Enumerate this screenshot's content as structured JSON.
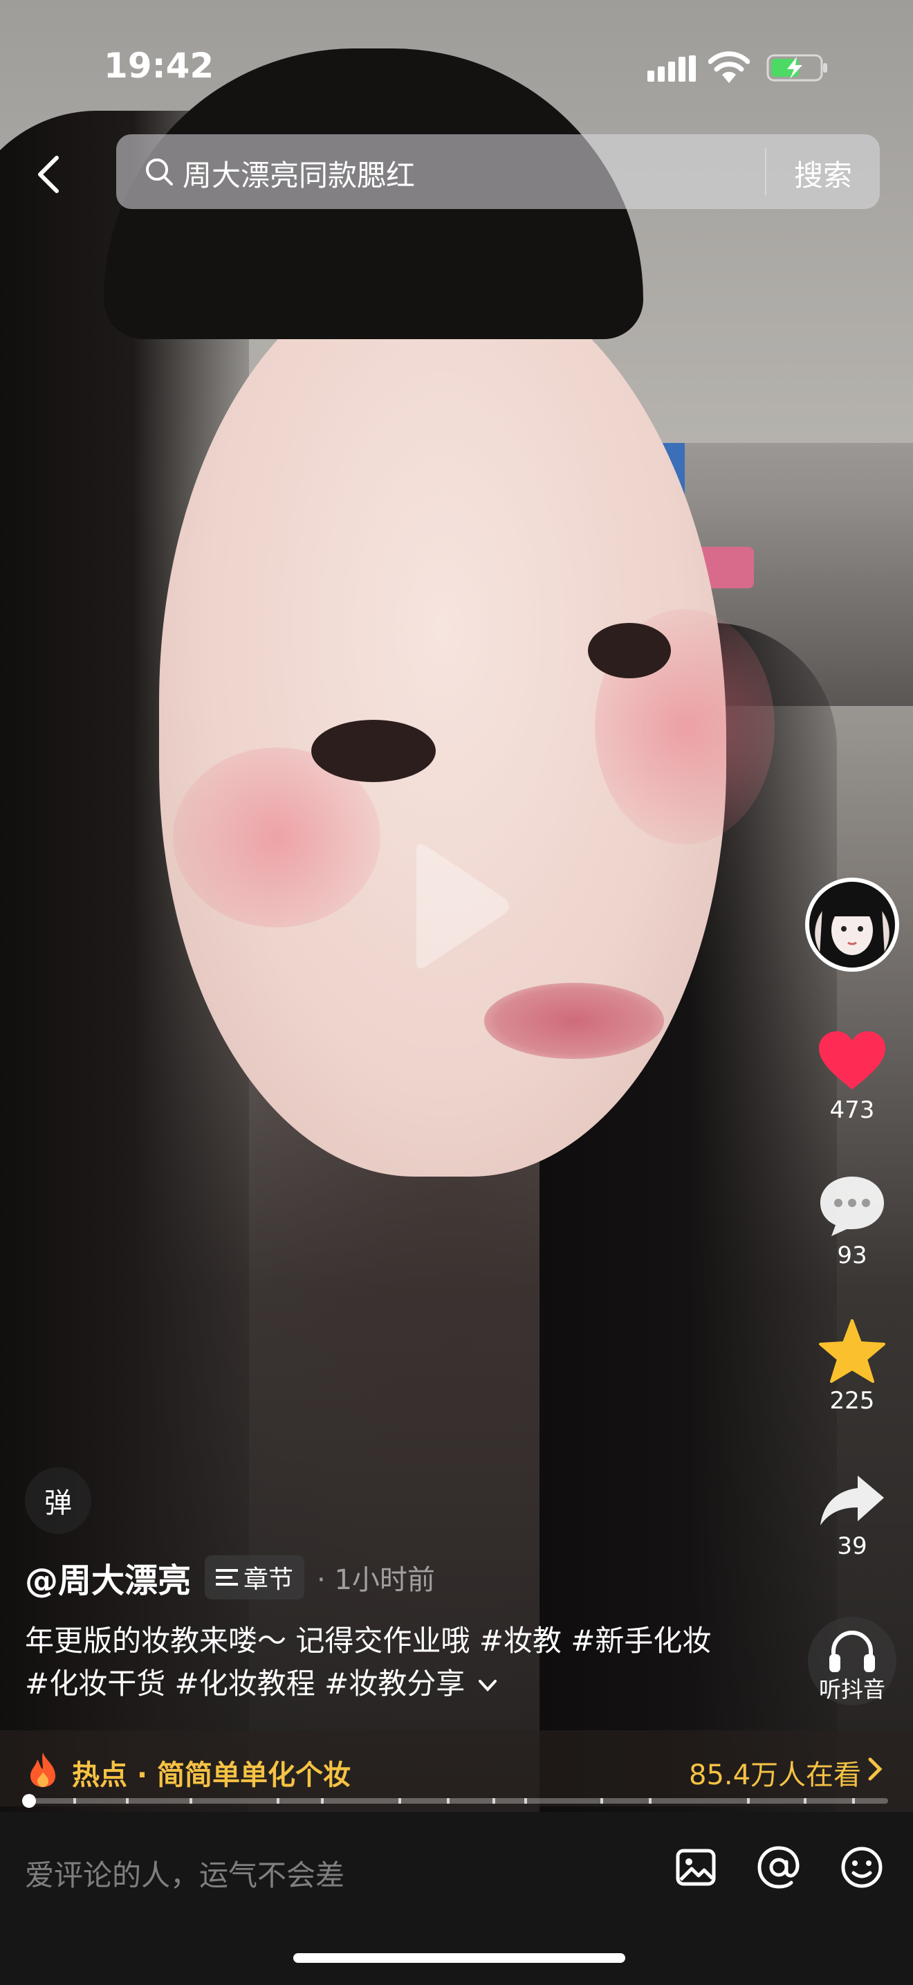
{
  "status_bar": {
    "time": "19:42"
  },
  "search": {
    "query": "周大漂亮同款腮红",
    "button_label": "搜索"
  },
  "side_rail": {
    "like_count": "473",
    "comment_count": "93",
    "favorite_count": "225",
    "share_count": "39",
    "listen_label": "听抖音"
  },
  "danmu": {
    "label": "弹"
  },
  "post": {
    "author": "@周大漂亮",
    "chapter_label": "章节",
    "time_ago": "· 1小时前",
    "description": "年更版的妆教来喽～ 记得交作业哦 #妆教 #新手化妆 #化妆干货 #化妆教程 #妆教分享"
  },
  "hot": {
    "label": "热点 · 简简单单化个妆",
    "viewers": "85.4万人在看"
  },
  "playback": {
    "progress_fraction": 0.005
  },
  "comment_bar": {
    "placeholder": "爱评论的人，运气不会差"
  },
  "colors": {
    "accent_like": "#fe2c55",
    "favorite": "#fbc02d",
    "hot": "#f6c244"
  }
}
